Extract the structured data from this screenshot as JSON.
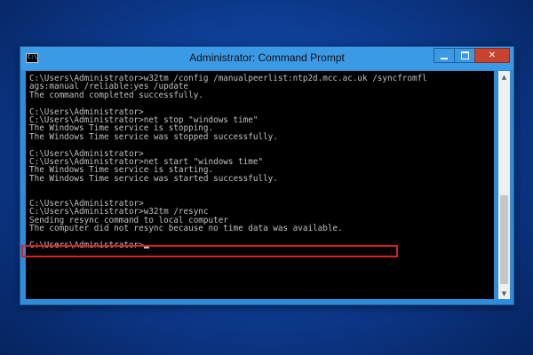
{
  "window": {
    "title": "Administrator: Command Prompt",
    "icon": "cmd-prompt-icon",
    "icon_text": "C:\\",
    "controls": {
      "minimize": "minimize-icon",
      "maximize": "maximize-icon",
      "close": "close-icon",
      "close_symbol": "✕"
    }
  },
  "console": {
    "lines": [
      "C:\\Users\\Administrator>w32tm /config /manualpeerlist:ntp2d.mcc.ac.uk /syncfromfl",
      "ags:manual /reliable:yes /update",
      "The command completed successfully.",
      "",
      "C:\\Users\\Administrator>",
      "C:\\Users\\Administrator>net stop \"windows time\"",
      "The Windows Time service is stopping.",
      "The Windows Time service was stopped successfully.",
      "",
      "C:\\Users\\Administrator>",
      "C:\\Users\\Administrator>net start \"windows time\"",
      "The Windows Time service is starting.",
      "The Windows Time service was started successfully.",
      "",
      "",
      "C:\\Users\\Administrator>",
      "C:\\Users\\Administrator>w32tm /resync",
      "Sending resync command to local computer",
      "The computer did not resync because no time data was available.",
      "",
      "C:\\Users\\Administrator>"
    ],
    "highlighted_line": "The computer did not resync because no time data was available.",
    "highlight_color": "#e02020",
    "text_color": "#c0c0c0",
    "background_color": "#000000"
  },
  "scrollbar": {
    "up_arrow": "▲",
    "down_arrow": "▼"
  },
  "theme": {
    "titlebar_color": "#3b9ae6",
    "close_button_color": "#c7432f",
    "desktop_color": "#0e3f98"
  }
}
